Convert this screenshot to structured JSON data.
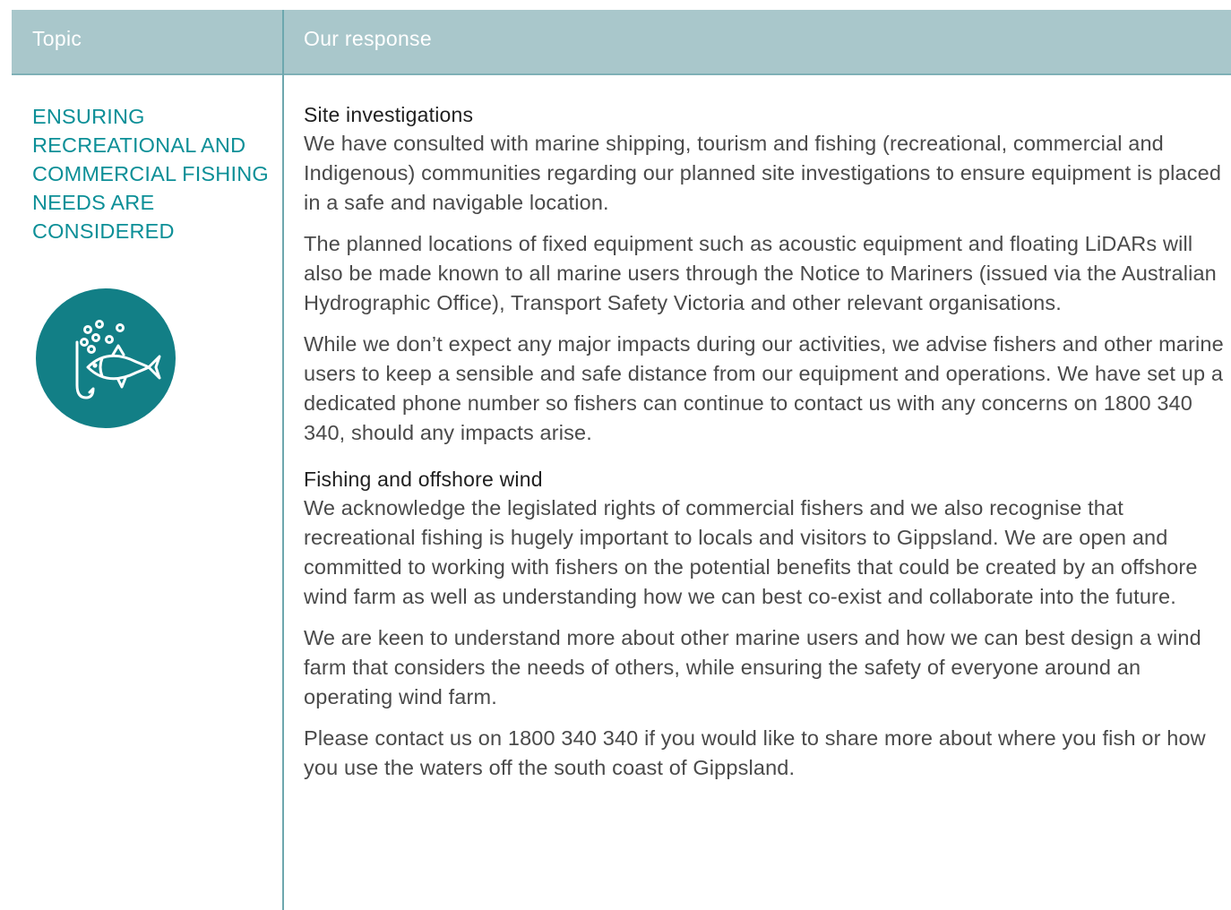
{
  "table": {
    "header": {
      "topic": "Topic",
      "response": "Our response"
    },
    "row": {
      "topic_title": "ENSURING RECREATIONAL AND COMMERCIAL FISHING NEEDS ARE CONSIDERED",
      "topic_icon": "fishing-hook-icon",
      "sections": [
        {
          "heading": "Site investigations",
          "paragraphs": [
            "We have consulted with marine shipping, tourism and fishing (recreational, commercial and Indigenous) communities regarding our planned site investigations to ensure equipment is placed in a safe and navigable location.",
            "The planned locations of fixed equipment such as acoustic equipment and floating LiDARs will also be made known to all marine users through the Notice to Mariners (issued via the Australian Hydrographic Office), Transport Safety Victoria and other relevant organisations.",
            "While we don’t expect any major impacts during our activities, we advise fishers and other marine users to keep a sensible and safe distance from our equipment and operations. We have set up a dedicated phone number so fishers can continue to contact us with any concerns on 1800 340 340, should any impacts arise."
          ]
        },
        {
          "heading": "Fishing and offshore wind",
          "paragraphs": [
            "We acknowledge the legislated rights of commercial fishers and we also recognise that recreational fishing is hugely important to locals and visitors to Gippsland. We are open and committed to working with fishers on the potential benefits that could be created by an offshore wind farm as well as understanding how we can best co-exist and collaborate into the future.",
            "We are keen to understand more about other marine users and how we can best design a wind farm that considers the needs of others, while ensuring the safety of everyone around an operating wind farm.",
            "Please contact us on 1800 340 340 if you would like to share more about where you fish or how you use the waters off the south coast of Gippsland."
          ]
        }
      ]
    }
  },
  "colors": {
    "header_bg": "#a9c7cb",
    "accent_teal": "#0c8f97",
    "icon_bg": "#127f86",
    "divider": "#6da7ae"
  }
}
